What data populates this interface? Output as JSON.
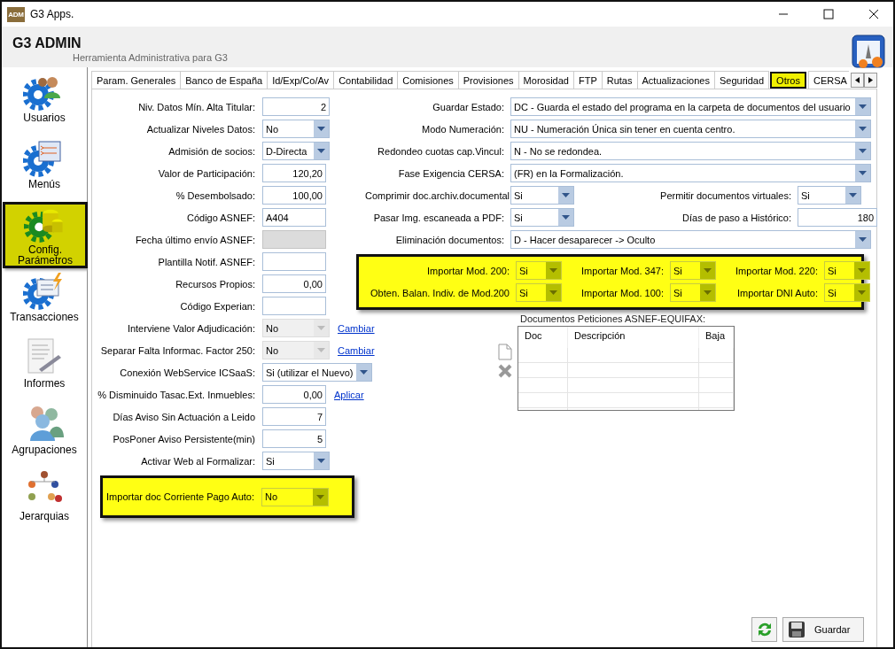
{
  "window": {
    "app_icon": "ADM",
    "title": "G3 Apps."
  },
  "header": {
    "title": "G3 ADMIN",
    "subtitle": "Herramienta Administrativa para G3"
  },
  "sidebar": {
    "items": [
      {
        "label": "Usuarios",
        "selected": false
      },
      {
        "label": "Menús",
        "selected": false
      },
      {
        "label": "Config. Parámetros",
        "selected": true
      },
      {
        "label": "Transacciones",
        "selected": false
      },
      {
        "label": "Informes",
        "selected": false
      },
      {
        "label": "Agrupaciones",
        "selected": false
      },
      {
        "label": "Jerarquias",
        "selected": false
      }
    ]
  },
  "tabs": [
    {
      "label": "Param. Generales",
      "selected": false
    },
    {
      "label": "Banco de España",
      "selected": false
    },
    {
      "label": "Id/Exp/Co/Av",
      "selected": false
    },
    {
      "label": "Contabilidad",
      "selected": false
    },
    {
      "label": "Comisiones",
      "selected": false
    },
    {
      "label": "Provisiones",
      "selected": false
    },
    {
      "label": "Morosidad",
      "selected": false
    },
    {
      "label": "FTP",
      "selected": false
    },
    {
      "label": "Rutas",
      "selected": false
    },
    {
      "label": "Actualizaciones",
      "selected": false
    },
    {
      "label": "Seguridad",
      "selected": false
    },
    {
      "label": "Otros",
      "selected": true
    },
    {
      "label": "CERSA",
      "selected": false
    }
  ],
  "left_fields": [
    {
      "label": "Niv. Datos Mín. Alta Titular:",
      "value": "2",
      "kind": "number",
      "disabled": false,
      "highlighted": false
    },
    {
      "label": "Actualizar Niveles Datos:",
      "value": "No",
      "kind": "combo",
      "disabled": false,
      "highlighted": false
    },
    {
      "label": "Admisión de socios:",
      "value": "D-Directa",
      "kind": "combo",
      "disabled": false,
      "highlighted": false
    },
    {
      "label": "Valor de Participación:",
      "value": "120,20",
      "kind": "number",
      "disabled": false,
      "highlighted": false
    },
    {
      "label": "% Desembolsado:",
      "value": "100,00",
      "kind": "number",
      "disabled": false,
      "highlighted": false
    },
    {
      "label": "Código ASNEF:",
      "value": "A404",
      "kind": "text",
      "disabled": false,
      "highlighted": false
    },
    {
      "label": "Fecha último envío ASNEF:",
      "kind": "text",
      "disabled": true,
      "highlighted": false
    },
    {
      "label": "Plantilla Notif. ASNEF:",
      "kind": "text",
      "disabled": false,
      "highlighted": false
    },
    {
      "label": "Recursos Propios:",
      "value": "0,00",
      "kind": "number",
      "disabled": false,
      "highlighted": false
    },
    {
      "label": "Código Experian:",
      "kind": "text",
      "disabled": false,
      "highlighted": false
    },
    {
      "label": "Interviene Valor Adjudicación:",
      "value": "No",
      "kind": "combo",
      "disabled": true,
      "highlighted": false,
      "link": "Cambiar"
    },
    {
      "label": "Separar Falta Informac. Factor 250:",
      "value": "No",
      "kind": "combo",
      "disabled": true,
      "highlighted": false,
      "link": "Cambiar"
    },
    {
      "label": "Conexión WebService ICSaaS:",
      "value": "Si (utilizar el Nuevo)",
      "kind": "combo",
      "disabled": false,
      "highlighted": false
    },
    {
      "label": "% Disminuido Tasac.Ext. Inmuebles:",
      "value": "0,00",
      "kind": "number",
      "disabled": false,
      "highlighted": false,
      "link": "Aplicar"
    },
    {
      "label": "Días Aviso Sin Actuación a Leido",
      "value": "7",
      "kind": "number",
      "disabled": false,
      "highlighted": false
    },
    {
      "label": "PosPoner Aviso Persistente(min)",
      "value": "5",
      "kind": "number",
      "disabled": false,
      "highlighted": false
    },
    {
      "label": "Activar Web al Formalizar:",
      "value": "Si",
      "kind": "combo",
      "disabled": false,
      "highlighted": false
    },
    {
      "label": "Importar doc Corriente Pago Auto:",
      "value": "No",
      "kind": "combo",
      "disabled": false,
      "highlighted": true
    }
  ],
  "right_fields": [
    {
      "label": "Guardar Estado:",
      "value": "DC - Guarda el estado del programa en la carpeta de documentos del usuario"
    },
    {
      "label": "Modo Numeración:",
      "value": "NU - Numeración Única sin tener en cuenta centro."
    },
    {
      "label": "Redondeo cuotas cap.Vincul:",
      "value": "N - No se redondea."
    },
    {
      "label": "Fase Exigencia CERSA:",
      "value": "(FR) en la Formalización."
    }
  ],
  "paired_rows": [
    [
      {
        "label": "Comprimir doc.archiv.documental:",
        "value": "Si",
        "kind": "combo"
      },
      {
        "label": "Permitir documentos virtuales:",
        "value": "Si",
        "kind": "combo"
      }
    ],
    [
      {
        "label": "Pasar Img. escaneada a PDF:",
        "value": "Si",
        "kind": "combo"
      },
      {
        "label": "Días de paso a Histórico:",
        "value": "180",
        "kind": "number"
      }
    ]
  ],
  "elimination": {
    "label": "Eliminación documentos:",
    "value": "D - Hacer desaparecer -> Oculto"
  },
  "import_options": {
    "highlighted": true,
    "rows": [
      [
        {
          "label": "Importar Mod. 200:",
          "value": "Si"
        },
        {
          "label": "Importar Mod. 347:",
          "value": "Si"
        },
        {
          "label": "Importar Mod. 220:",
          "value": "Si"
        }
      ],
      [
        {
          "label": "Obten. Balan. Indiv. de Mod.200",
          "value": "Si"
        },
        {
          "label": "Importar Mod. 100:",
          "value": "Si"
        },
        {
          "label": "Importar DNI Auto:",
          "value": "Si"
        }
      ]
    ]
  },
  "documents": {
    "title": "Documentos Peticiones ASNEF-EQUIFAX:",
    "columns": [
      "Doc",
      "Descripción",
      "Baja"
    ]
  },
  "buttons": {
    "save": "Guardar"
  }
}
